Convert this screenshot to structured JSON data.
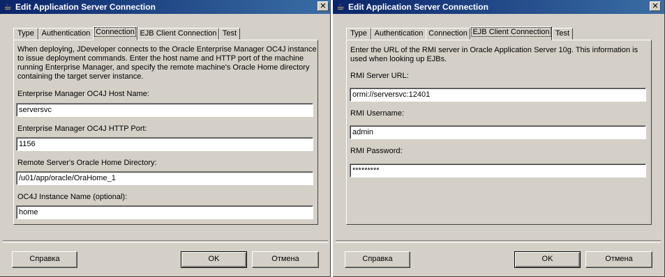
{
  "left": {
    "title": "Edit Application Server Connection",
    "tabs": [
      "Type",
      "Authentication",
      "Connection",
      "EJB Client Connection",
      "Test"
    ],
    "active_tab": "Connection",
    "description": [
      "When deploying, JDeveloper connects to the Oracle Enterprise Manager OC4J instance",
      "to issue deployment commands. Enter the host name and HTTP port of the machine",
      "running Enterprise Manager, and specify the remote machine's Oracle Home directory",
      "containing the target server instance."
    ],
    "fields": [
      {
        "label": "Enterprise Manager OC4J Host Name:",
        "value": "serversvc"
      },
      {
        "label": "Enterprise Manager OC4J HTTP Port:",
        "value": "1156"
      },
      {
        "label": "Remote Server's Oracle Home Directory:",
        "value": "/u01/app/oracle/OraHome_1"
      },
      {
        "label": "OC4J Instance Name (optional):",
        "value": "home"
      }
    ],
    "buttons": {
      "help": "Справка",
      "ok": "OK",
      "cancel": "Отмена"
    }
  },
  "right": {
    "title": "Edit Application Server Connection",
    "tabs": [
      "Type",
      "Authentication",
      "Connection",
      "EJB Client Connection",
      "Test"
    ],
    "active_tab": "EJB Client Connection",
    "description": [
      "Enter the URL of the RMI server in Oracle Application Server 10g. This information is",
      "used when looking up EJBs."
    ],
    "fields": [
      {
        "label": "RMI Server URL:",
        "value": "ormi://serversvc:12401"
      },
      {
        "label": "RMI Username:",
        "value": "admin"
      },
      {
        "label": "RMI Password:",
        "value": "*********"
      }
    ],
    "buttons": {
      "help": "Справка",
      "ok": "OK",
      "cancel": "Отмена"
    }
  },
  "icons": {
    "title_icon": "java-cup-icon",
    "close": "close-icon"
  }
}
